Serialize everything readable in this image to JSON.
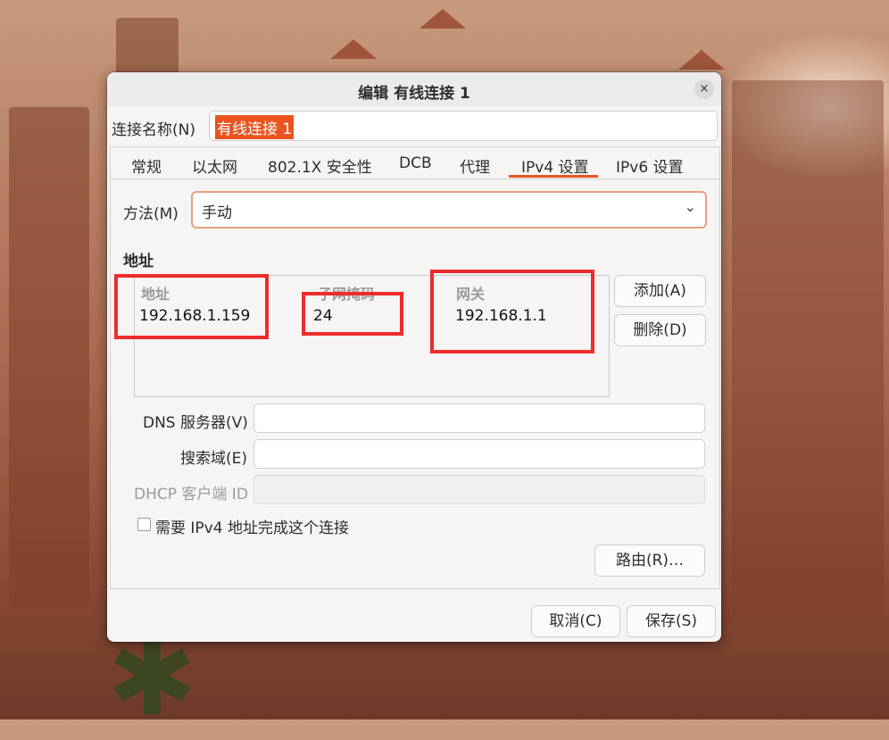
{
  "dialog": {
    "title": "编辑 有线连接 1",
    "close_icon": "×",
    "connection_name_label": "连接名称(N)",
    "connection_name_value": "有线连接 1"
  },
  "tabs": [
    {
      "label": "常规"
    },
    {
      "label": "以太网"
    },
    {
      "label": "802.1X 安全性"
    },
    {
      "label": "DCB"
    },
    {
      "label": "代理"
    },
    {
      "label": "IPv4 设置",
      "active": true
    },
    {
      "label": "IPv6 设置"
    }
  ],
  "ipv4": {
    "method_label": "方法(M)",
    "method_value": "手动",
    "dropdown_arrow": "⌄",
    "address_section": "地址",
    "columns": {
      "address": "地址",
      "netmask": "子网掩码",
      "gateway": "网关"
    },
    "row": {
      "address": "192.168.1.159",
      "netmask": "24",
      "gateway": "192.168.1.1"
    },
    "add_button": "添加(A)",
    "delete_button": "删除(D)",
    "dns_label": "DNS 服务器(V)",
    "dns_value": "",
    "search_label": "搜索域(E)",
    "search_value": "",
    "dhcp_label": "DHCP 客户端 ID",
    "dhcp_value": "",
    "require_ipv4_label": "需要 IPv4 地址完成这个连接",
    "require_ipv4_checked": false,
    "routes_button": "路由(R)…"
  },
  "footer": {
    "cancel_button": "取消(C)",
    "save_button": "保存(S)"
  },
  "colors": {
    "accent": "#e95420",
    "highlight_box": "#ee2c2c"
  }
}
